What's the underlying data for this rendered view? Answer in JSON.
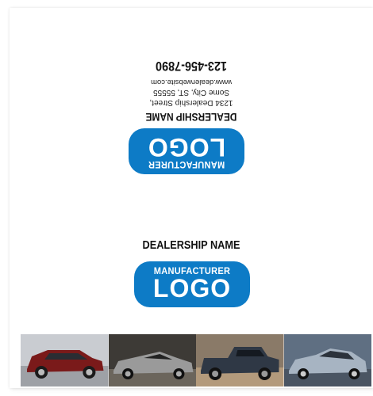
{
  "dealer": {
    "name": "DEALERSHIP NAME",
    "street": "1234 Dealership Street,",
    "city": "Some City, ST, 55555",
    "website": "www.dealerwebsite.com",
    "phone": "123-456-7890"
  },
  "logo": {
    "top": "MANUFACTURER",
    "main": "LOGO",
    "color": "#0d7bc6"
  },
  "photos": [
    {
      "color": "#7a1a1a",
      "icon": "red-suv"
    },
    {
      "color": "#8b8b8b",
      "icon": "silver-sports-car"
    },
    {
      "color": "#2f3845",
      "icon": "dark-pickup-truck"
    },
    {
      "color": "#a7b4c2",
      "icon": "silver-sedan"
    }
  ]
}
